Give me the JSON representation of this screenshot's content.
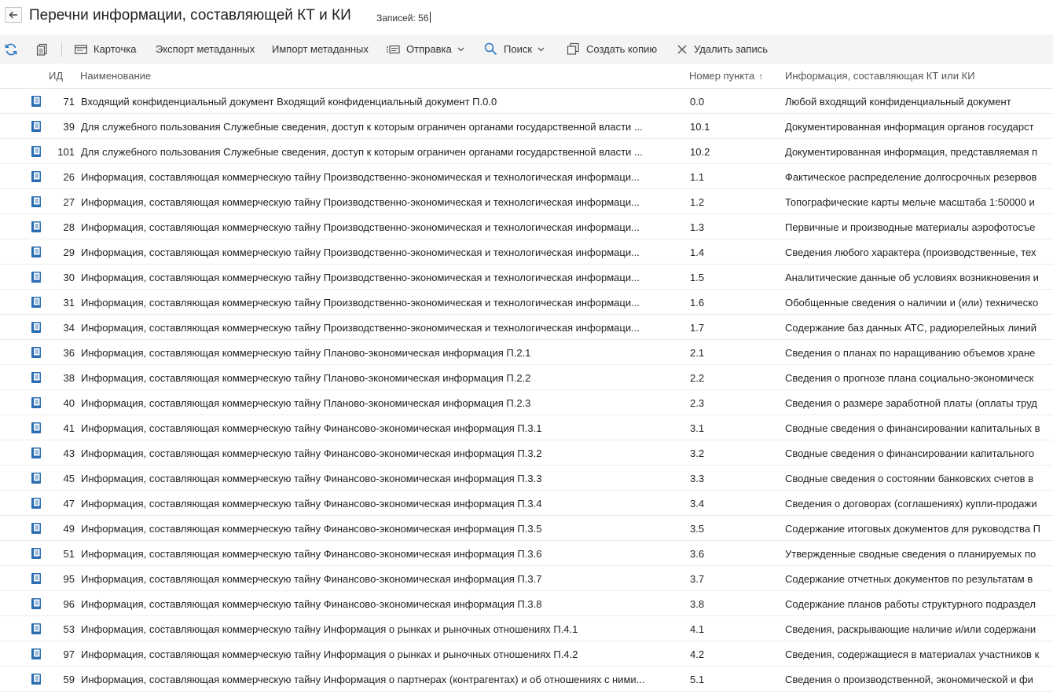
{
  "header": {
    "title": "Перечни информации, составляющей КТ и КИ",
    "records_label": "Записей: 56"
  },
  "toolbar": {
    "card": "Карточка",
    "export_meta": "Экспорт метаданных",
    "import_meta": "Импорт метаданных",
    "send": "Отправка",
    "search": "Поиск",
    "copy": "Создать копию",
    "delete": "Удалить запись"
  },
  "columns": {
    "id": "ИД",
    "name": "Наименование",
    "num": "Номер пункта",
    "info": "Информация, составляющая КТ или КИ"
  },
  "rows": [
    {
      "id": "71",
      "name": "Входящий конфиденциальный документ Входящий конфиденциальный документ П.0.0",
      "num": "0.0",
      "info": "Любой входящий конфиденциальный документ"
    },
    {
      "id": "39",
      "name": "Для служебного пользования Служебные сведения, доступ к которым ограничен органами государственной власти ...",
      "num": "10.1",
      "info": "Документированная информация органов государст"
    },
    {
      "id": "101",
      "name": "Для служебного пользования Служебные сведения, доступ к которым ограничен органами государственной власти ...",
      "num": "10.2",
      "info": "Документированная информация, представляемая п"
    },
    {
      "id": "26",
      "name": "Информация, составляющая коммерческую тайну Производственно-экономическая и технологическая информаци...",
      "num": "1.1",
      "info": "Фактическое распределение долгосрочных резервов"
    },
    {
      "id": "27",
      "name": "Информация, составляющая коммерческую тайну Производственно-экономическая и технологическая информаци...",
      "num": "1.2",
      "info": "Топографические карты мельче масштаба 1:50000 и"
    },
    {
      "id": "28",
      "name": "Информация, составляющая коммерческую тайну Производственно-экономическая и технологическая информаци...",
      "num": "1.3",
      "info": "Первичные и производные материалы аэрофотосъе"
    },
    {
      "id": "29",
      "name": "Информация, составляющая коммерческую тайну Производственно-экономическая и технологическая информаци...",
      "num": "1.4",
      "info": "Сведения любого характера (производственные, тех"
    },
    {
      "id": "30",
      "name": "Информация, составляющая коммерческую тайну Производственно-экономическая и технологическая информаци...",
      "num": "1.5",
      "info": "Аналитические данные об условиях возникновения и"
    },
    {
      "id": "31",
      "name": "Информация, составляющая коммерческую тайну Производственно-экономическая и технологическая информаци...",
      "num": "1.6",
      "info": "Обобщенные сведения о наличии и (или) техническо"
    },
    {
      "id": "34",
      "name": "Информация, составляющая коммерческую тайну Производственно-экономическая и технологическая информаци...",
      "num": "1.7",
      "info": "Содержание баз данных АТС, радиорелейных линий"
    },
    {
      "id": "36",
      "name": "Информация, составляющая коммерческую тайну Планово-экономическая информация П.2.1",
      "num": "2.1",
      "info": "Сведения о планах по наращиванию объемов хране"
    },
    {
      "id": "38",
      "name": "Информация, составляющая коммерческую тайну Планово-экономическая информация П.2.2",
      "num": "2.2",
      "info": "Сведения о прогнозе плана социально-экономическ"
    },
    {
      "id": "40",
      "name": "Информация, составляющая коммерческую тайну Планово-экономическая информация П.2.3",
      "num": "2.3",
      "info": "Сведения о размере заработной платы (оплаты труд"
    },
    {
      "id": "41",
      "name": "Информация, составляющая коммерческую тайну Финансово-экономическая информация П.3.1",
      "num": "3.1",
      "info": "Сводные сведения о финансировании капитальных в"
    },
    {
      "id": "43",
      "name": "Информация, составляющая коммерческую тайну Финансово-экономическая информация П.3.2",
      "num": "3.2",
      "info": "Сводные сведения о финансировании капитального"
    },
    {
      "id": "45",
      "name": "Информация, составляющая коммерческую тайну Финансово-экономическая информация П.3.3",
      "num": "3.3",
      "info": "Сводные сведения о состоянии банковских счетов в"
    },
    {
      "id": "47",
      "name": "Информация, составляющая коммерческую тайну Финансово-экономическая информация П.3.4",
      "num": "3.4",
      "info": "Сведения о договорах (соглашениях) купли-продажи"
    },
    {
      "id": "49",
      "name": "Информация, составляющая коммерческую тайну Финансово-экономическая информация П.3.5",
      "num": "3.5",
      "info": "Содержание итоговых документов для руководства П"
    },
    {
      "id": "51",
      "name": "Информация, составляющая коммерческую тайну Финансово-экономическая информация П.3.6",
      "num": "3.6",
      "info": "Утвержденные сводные сведения о планируемых по"
    },
    {
      "id": "95",
      "name": "Информация, составляющая коммерческую тайну Финансово-экономическая информация П.3.7",
      "num": "3.7",
      "info": "Содержание отчетных документов по результатам в"
    },
    {
      "id": "96",
      "name": "Информация, составляющая коммерческую тайну Финансово-экономическая информация П.3.8",
      "num": "3.8",
      "info": "Содержание планов работы структурного подраздел"
    },
    {
      "id": "53",
      "name": "Информация, составляющая коммерческую тайну Информация о рынках и рыночных отношениях П.4.1",
      "num": "4.1",
      "info": "Сведения, раскрывающие наличие и/или содержани"
    },
    {
      "id": "97",
      "name": "Информация, составляющая коммерческую тайну Информация о рынках и рыночных отношениях П.4.2",
      "num": "4.2",
      "info": "Сведения, содержащиеся в материалах участников к"
    },
    {
      "id": "59",
      "name": "Информация, составляющая коммерческую тайну Информация о партнерах (контрагентах) и об отношениях с ними...",
      "num": "5.1",
      "info": "Сведения о производственной, экономической и фи"
    }
  ]
}
